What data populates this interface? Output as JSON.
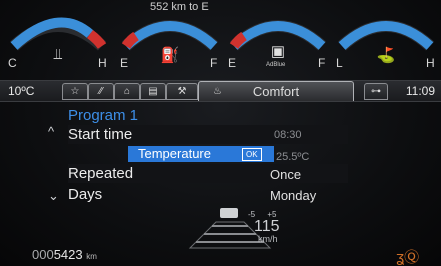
{
  "range_text": "552 km to E",
  "gauges": [
    {
      "id": "coolant",
      "left_label": "C",
      "right_label": "H",
      "icon": "coolant-temperature-icon",
      "glyph": "⫫"
    },
    {
      "id": "fuel",
      "left_label": "E",
      "right_label": "F",
      "icon": "fuel-pump-icon",
      "glyph": "⛽"
    },
    {
      "id": "adblue",
      "left_label": "E",
      "right_label": "F",
      "icon": "adblue-icon",
      "glyph": "▣",
      "sub": "AdBlue"
    },
    {
      "id": "oil",
      "left_label": "L",
      "right_label": "H",
      "icon": "oil-can-icon",
      "glyph": "⛳"
    }
  ],
  "status": {
    "outside_temp": "10ºC",
    "time": "11:09"
  },
  "tabs": [
    {
      "name": "tab-favorites",
      "icon": "star-icon",
      "glyph": "☆"
    },
    {
      "name": "tab-trip",
      "icon": "road-icon",
      "glyph": "⁄⁄"
    },
    {
      "name": "tab-driver-assist",
      "icon": "car-assist-icon",
      "glyph": "⌂"
    },
    {
      "name": "tab-audio",
      "icon": "audio-icon",
      "glyph": "▤"
    },
    {
      "name": "tab-settings",
      "icon": "wrench-icon",
      "glyph": "⚒"
    },
    {
      "name": "tab-comfort",
      "icon": "heat-icon",
      "glyph": "♨",
      "label": "Comfort",
      "active": true
    },
    {
      "name": "tab-display",
      "icon": "display-settings-icon",
      "glyph": "⊶"
    }
  ],
  "menu": {
    "title": "Program 1",
    "items": [
      {
        "label": "Start time",
        "value": "08:30"
      },
      {
        "label": "Temperature",
        "value": "25.5ºC",
        "badge": "OK"
      },
      {
        "label": "Repeated",
        "value": "Once"
      },
      {
        "label": "Days",
        "value": "Monday"
      }
    ]
  },
  "speed": {
    "value": "115",
    "unit": "km/h",
    "minus": "-5",
    "plus": "+5"
  },
  "odometer": {
    "prefix": "000",
    "value": "5423",
    "unit": "km"
  }
}
